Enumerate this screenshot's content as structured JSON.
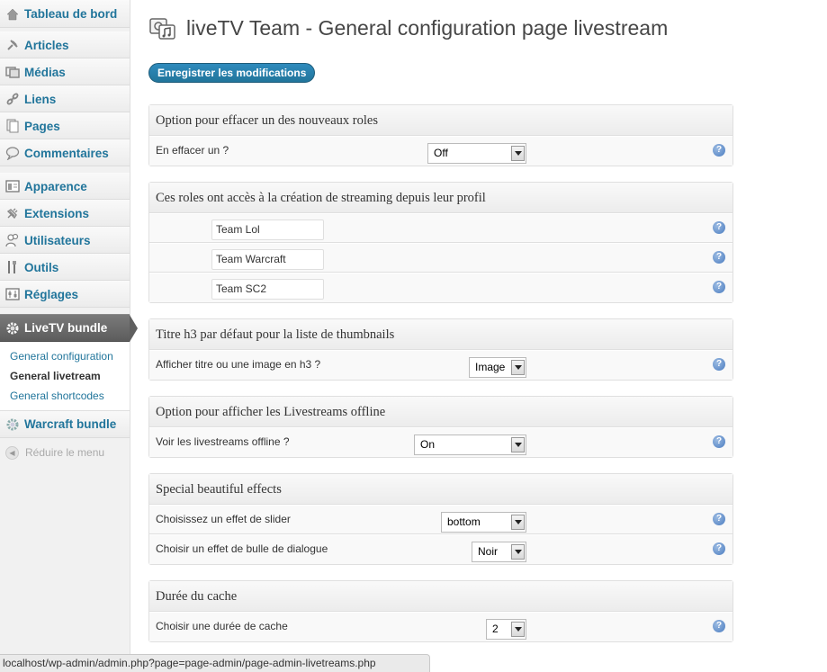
{
  "sidebar": {
    "items": [
      {
        "label": "Tableau de bord",
        "icon": "house-icon"
      },
      {
        "label": "Articles",
        "icon": "pin-icon"
      },
      {
        "label": "Médias",
        "icon": "media-icon"
      },
      {
        "label": "Liens",
        "icon": "link-icon"
      },
      {
        "label": "Pages",
        "icon": "pages-icon"
      },
      {
        "label": "Commentaires",
        "icon": "comment-icon"
      },
      {
        "label": "Apparence",
        "icon": "appearance-icon"
      },
      {
        "label": "Extensions",
        "icon": "plugin-icon"
      },
      {
        "label": "Utilisateurs",
        "icon": "users-icon"
      },
      {
        "label": "Outils",
        "icon": "tools-icon"
      },
      {
        "label": "Réglages",
        "icon": "settings-icon"
      }
    ],
    "active": {
      "label": "LiveTV bundle",
      "icon": "gear-icon"
    },
    "submenu": [
      "General configuration",
      "General livetream",
      "General shortcodes"
    ],
    "warcraft": {
      "label": "Warcraft bundle",
      "icon": "gear-icon"
    },
    "collapse": "Réduire le menu"
  },
  "header": {
    "title": "liveTV Team - General configuration page livestream",
    "save_label": "Enregistrer les modifications"
  },
  "sections": {
    "roles_delete": {
      "title": "Option pour effacer un des nouveaux roles",
      "label": "En effacer un ?",
      "value": "Off"
    },
    "roles_access": {
      "title": "Ces roles ont accès à la création de streaming depuis leur profil",
      "inputs": [
        "Team Lol",
        "Team Warcraft",
        "Team SC2"
      ]
    },
    "thumbnails": {
      "title": "Titre h3 par défaut pour la liste de thumbnails",
      "label": "Afficher titre ou une image en h3 ?",
      "value": "Image"
    },
    "offline": {
      "title": "Option pour afficher les Livestreams offline",
      "label": "Voir les livestreams offline ?",
      "value": "On"
    },
    "effects": {
      "title": "Special beautiful effects",
      "slider_label": "Choisissez un effet de slider",
      "slider_value": "bottom",
      "bubble_label": "Choisir un effet de bulle de dialogue",
      "bubble_value": "Noir"
    },
    "cache": {
      "title": "Durée du cache",
      "label": "Choisir une durée de cache",
      "value": "2"
    }
  },
  "help_glyph": "?",
  "status_url": "localhost/wp-admin/admin.php?page=page-admin/page-admin-livetreams.php"
}
